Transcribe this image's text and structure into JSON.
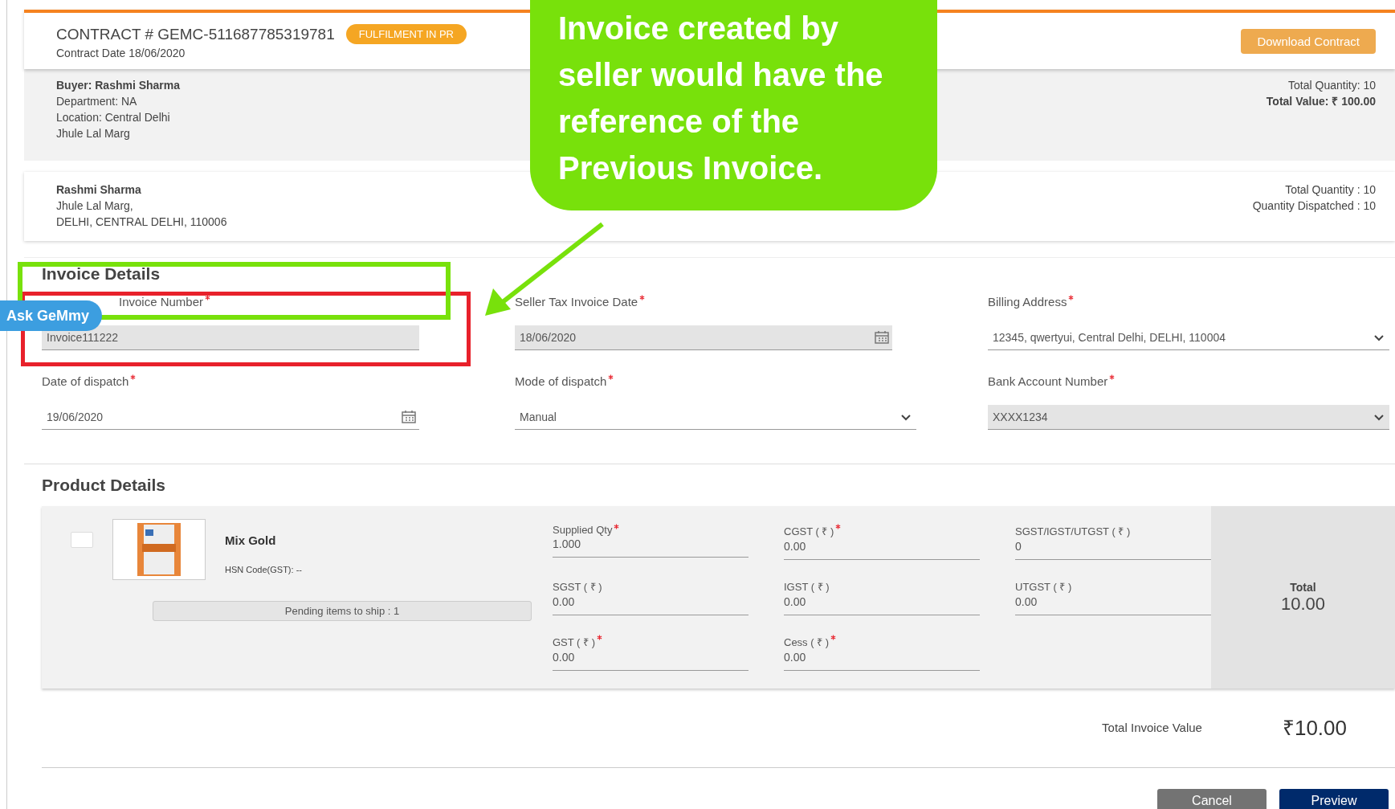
{
  "contract": {
    "title": "CONTRACT # GEMC-511687785319781",
    "date": "Contract Date 18/06/2020",
    "status": "FULFILMENT IN PR",
    "download_button": "Download Contract"
  },
  "buyer": {
    "name": "Buyer: Rashmi Sharma",
    "lines": [
      "Department: NA",
      "Location: Central Delhi",
      "Jhule Lal Marg"
    ],
    "total_quantity": "Total Quantity: 10",
    "total_value": "Total Value: ₹ 100.00"
  },
  "consignee": {
    "name": "Rashmi Sharma",
    "lines": [
      "Jhule Lal Marg,",
      "DELHI, CENTRAL DELHI, 110006"
    ],
    "stats": [
      "Total Quantity : 10",
      "Quantity Dispatched : 10"
    ]
  },
  "invoice_details": {
    "title": "Invoice Details",
    "fields": [
      {
        "label": "Invoice Number",
        "required": true,
        "value": "Invoice111222",
        "kind": "text",
        "disabled": true
      },
      {
        "label": "Seller Tax Invoice Date",
        "required": true,
        "value": "18/06/2020",
        "kind": "date",
        "disabled": true
      },
      {
        "label": "Billing Address",
        "required": true,
        "value": "12345, qwertyui, Central Delhi, DELHI, 110004",
        "kind": "select",
        "disabled": false
      },
      {
        "label": "Date of dispatch",
        "required": true,
        "value": "19/06/2020",
        "kind": "date",
        "disabled": false
      },
      {
        "label": "Mode of dispatch",
        "required": true,
        "value": "Manual",
        "kind": "select",
        "disabled": false
      },
      {
        "label": "Bank Account Number",
        "required": true,
        "value": "XXXX1234",
        "kind": "select",
        "disabled": true
      }
    ]
  },
  "product_details": {
    "title": "Product Details",
    "product": {
      "checked": false,
      "name": "Mix Gold",
      "hsn": "HSN Code(GST): --",
      "pending": "Pending items to ship : 1",
      "fields": [
        {
          "label": "Supplied Qty",
          "required": true,
          "value": "1.000"
        },
        {
          "label": "CGST ( ₹ )",
          "required": true,
          "value": "0.00"
        },
        {
          "label": "SGST/IGST/UTGST ( ₹ )",
          "required": false,
          "value": "0"
        },
        {
          "label": "SGST ( ₹ )",
          "required": false,
          "value": "0.00"
        },
        {
          "label": "IGST ( ₹ )",
          "required": false,
          "value": "0.00"
        },
        {
          "label": "UTGST ( ₹ )",
          "required": false,
          "value": "0.00"
        },
        {
          "label": "GST ( ₹ )",
          "required": true,
          "value": "0.00"
        },
        {
          "label": "Cess ( ₹ )",
          "required": true,
          "value": "0.00"
        }
      ],
      "total_label": "Total",
      "total_value": "10.00"
    }
  },
  "total_invoice": {
    "label": "Total Invoice Value",
    "value": "₹10.00"
  },
  "buttons": [
    {
      "label": "Cancel",
      "kind": "secondary"
    },
    {
      "label": "Preview",
      "kind": "primary"
    }
  ],
  "annotation": {
    "text": "Invoice created by seller would have the reference of the Previous Invoice."
  },
  "assistant_chip": "Ask GeMmy"
}
